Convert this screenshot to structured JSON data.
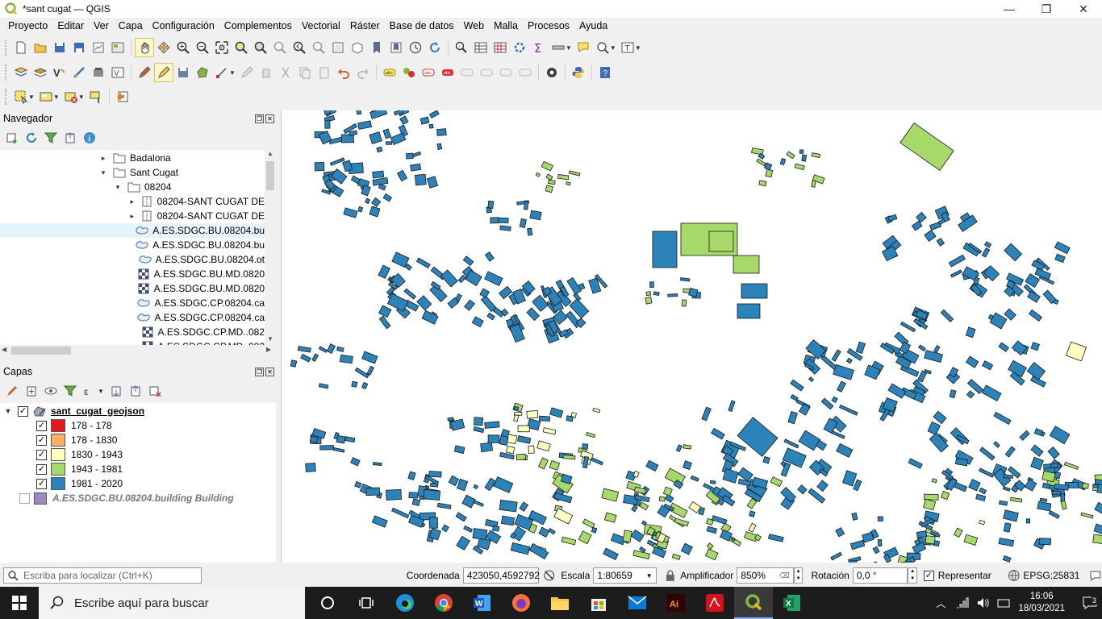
{
  "window": {
    "title": "*sant cugat — QGIS",
    "min": "—",
    "restore": "❐",
    "close": "✕"
  },
  "menus": [
    "Proyecto",
    "Editar",
    "Ver",
    "Capa",
    "Configuración",
    "Complementos",
    "Vectorial",
    "Ráster",
    "Base de datos",
    "Web",
    "Malla",
    "Procesos",
    "Ayuda"
  ],
  "navigator": {
    "title": "Navegador",
    "items": [
      {
        "label": "Badalona",
        "depth": 2,
        "arrow": "▸",
        "icon": "folder"
      },
      {
        "label": "Sant Cugat",
        "depth": 2,
        "arrow": "▾",
        "icon": "folder"
      },
      {
        "label": "08204",
        "depth": 3,
        "arrow": "▾",
        "icon": "folder"
      },
      {
        "label": "08204-SANT CUGAT DE",
        "depth": 4,
        "arrow": "▸",
        "icon": "zip"
      },
      {
        "label": "08204-SANT CUGAT DE",
        "depth": 4,
        "arrow": "▸",
        "icon": "zip"
      },
      {
        "label": "A.ES.SDGC.BU.08204.bu",
        "depth": 4,
        "arrow": "",
        "icon": "polygon",
        "highlight": true
      },
      {
        "label": "A.ES.SDGC.BU.08204.bu",
        "depth": 4,
        "arrow": "",
        "icon": "polygon"
      },
      {
        "label": "A.ES.SDGC.BU.08204.ot",
        "depth": 4,
        "arrow": "",
        "icon": "polygon"
      },
      {
        "label": "A.ES.SDGC.BU.MD.0820",
        "depth": 4,
        "arrow": "",
        "icon": "raster"
      },
      {
        "label": "A.ES.SDGC.BU.MD.0820",
        "depth": 4,
        "arrow": "",
        "icon": "raster"
      },
      {
        "label": "A.ES.SDGC.CP.08204.ca",
        "depth": 4,
        "arrow": "",
        "icon": "polygon"
      },
      {
        "label": "A.ES.SDGC.CP.08204.ca",
        "depth": 4,
        "arrow": "",
        "icon": "polygon"
      },
      {
        "label": "A.ES.SDGC.CP.MD..082",
        "depth": 4,
        "arrow": "",
        "icon": "raster"
      },
      {
        "label": "A.ES.SDGC.CP.MD..082",
        "depth": 4,
        "arrow": "",
        "icon": "raster"
      }
    ]
  },
  "layers": {
    "title": "Capas",
    "main_layer": "sant_cugat_geojson",
    "classes": [
      {
        "label": "178 - 178",
        "color": "#e31a1c"
      },
      {
        "label": "178 - 1830",
        "color": "#fdae61"
      },
      {
        "label": "1830 - 1943",
        "color": "#ffffc0"
      },
      {
        "label": "1943 - 1981",
        "color": "#a6d96a"
      },
      {
        "label": "1981 - 2020",
        "color": "#2b83ba"
      }
    ],
    "second_layer": "A.ES.SDGC.BU.08204.building Building",
    "second_color": "#9e87c4"
  },
  "status": {
    "locator_placeholder": "Escriba para localizar (Ctrl+K)",
    "coord_label": "Coordenada",
    "coord_value": "423050,4592792",
    "scale_label": "Escala",
    "scale_value": "1:80659",
    "magnifier_label": "Amplificador",
    "magnifier_value": "850%",
    "rotation_label": "Rotación",
    "rotation_value": "0,0 °",
    "render_label": "Representar",
    "crs": "EPSG:25831"
  },
  "taskbar": {
    "search": "Escribe aquí para buscar",
    "time": "16:06",
    "date": "18/03/2021",
    "notifications": "3"
  },
  "colors": {
    "blue": "#2b83ba",
    "green": "#a6d96a",
    "yellow": "#ffffc0",
    "orange": "#fdae61",
    "red": "#e31a1c"
  }
}
